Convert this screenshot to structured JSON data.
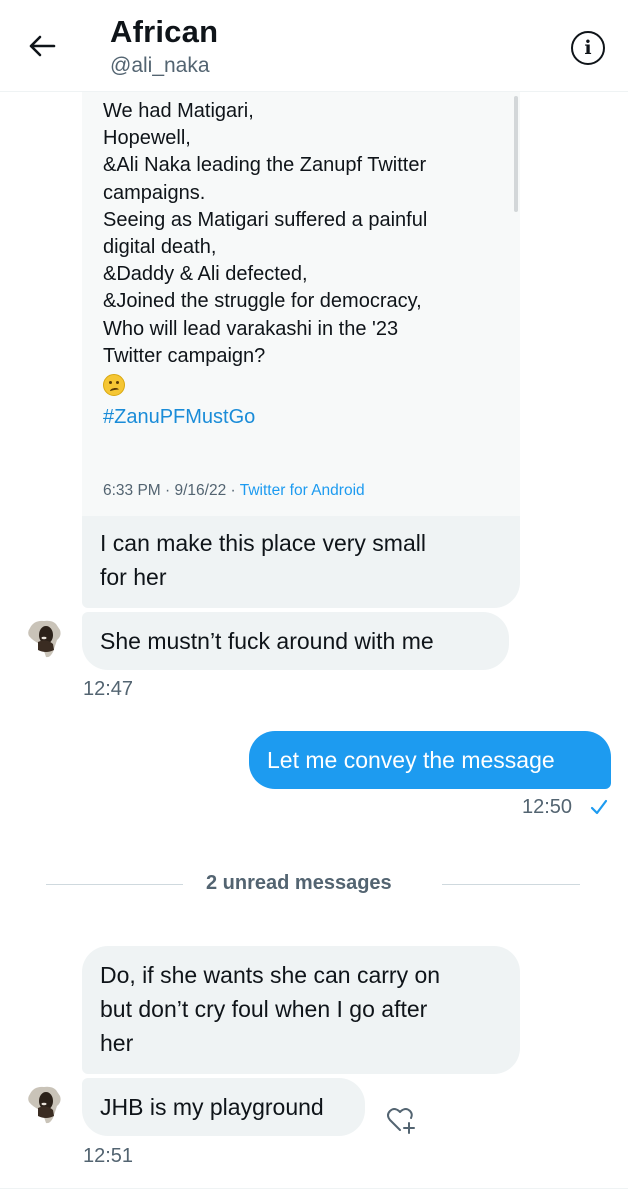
{
  "header": {
    "title": "African",
    "handle": "@ali_naka"
  },
  "quoted_tweet": {
    "lines": [
      "We had Matigari,",
      "Hopewell,",
      "&Ali Naka leading the Zanupf Twitter",
      "campaigns.",
      "Seeing as Matigari suffered a painful",
      "digital death,",
      "&Daddy & Ali defected,",
      "&Joined the struggle for democracy,",
      "Who will lead varakashi in the '23",
      "Twitter campaign?"
    ],
    "emoji": "thinking-face",
    "hashtag": "#ZanuPFMustGo",
    "timestamp": "6:33 PM · 9/16/22 · ",
    "source": "Twitter for Android"
  },
  "messages": {
    "m1_lines": [
      "I can make this place very small",
      "for her"
    ],
    "m2": "She mustn’t fuck around with me",
    "time1": "12:47",
    "m3": "Let me convey the message",
    "time2": "12:50",
    "unread_divider": "2 unread messages",
    "m4_lines": [
      "Do, if she wants she can carry on",
      "but don’t cry foul when I go after",
      "her"
    ],
    "m5": "JHB is my playground",
    "time3": "12:51"
  },
  "colors": {
    "accent": "#1d9bf0",
    "incoming_bubble": "#eff3f4",
    "secondary_text": "#536471"
  },
  "icons": [
    "back-arrow-icon",
    "info-icon",
    "read-check-icon",
    "add-reaction-icon",
    "avatar-africa-silhouette"
  ]
}
